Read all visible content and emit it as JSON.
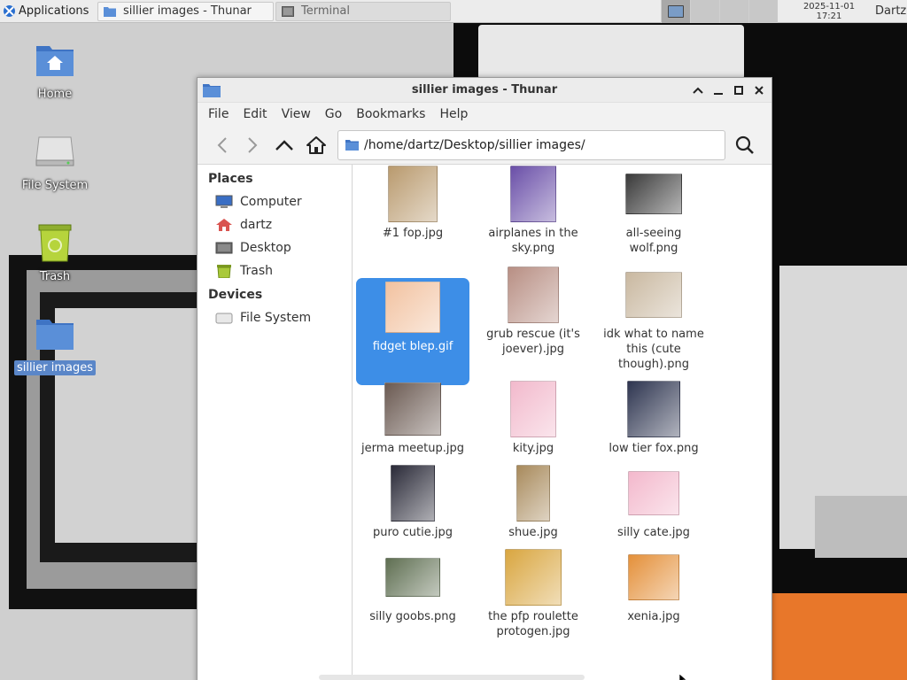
{
  "panel": {
    "applications_label": "Applications",
    "tasks": [
      {
        "label": "sillier images - Thunar"
      },
      {
        "label": "Terminal"
      }
    ],
    "clock_date": "2025-11-01",
    "clock_time": "17:21",
    "user": "Dartz"
  },
  "desktop": {
    "icons": [
      {
        "label": "Home"
      },
      {
        "label": "File System"
      },
      {
        "label": "Trash"
      },
      {
        "label": "sillier images"
      }
    ]
  },
  "window": {
    "title": "sillier images - Thunar",
    "menu": [
      "File",
      "Edit",
      "View",
      "Go",
      "Bookmarks",
      "Help"
    ],
    "location": "/home/dartz/Desktop/sillier images/",
    "sidebar": {
      "places_heading": "Places",
      "places": [
        {
          "label": "Computer"
        },
        {
          "label": "dartz"
        },
        {
          "label": "Desktop"
        },
        {
          "label": "Trash"
        }
      ],
      "devices_heading": "Devices",
      "devices": [
        {
          "label": "File System"
        }
      ]
    },
    "files": [
      {
        "name": "#1 fop.jpg",
        "color": "#b99a6e"
      },
      {
        "name": "airplanes in the sky.png",
        "color": "#6a4fa8"
      },
      {
        "name": "all-seeing wolf.png",
        "color": "#3a3a3a"
      },
      {
        "name": "fidget blep.gif",
        "color": "#f2c2a0",
        "selected": true
      },
      {
        "name": "grub rescue (it's joever).jpg",
        "color": "#b88f84"
      },
      {
        "name": "idk what to name this (cute though).png",
        "color": "#c9b8a0"
      },
      {
        "name": "jerma meetup.jpg",
        "color": "#6b5a52"
      },
      {
        "name": "kity.jpg",
        "color": "#f2b9cc"
      },
      {
        "name": "low tier fox.png",
        "color": "#2e3550"
      },
      {
        "name": "puro cutie.jpg",
        "color": "#2a2a38"
      },
      {
        "name": "shue.jpg",
        "color": "#a88a5c"
      },
      {
        "name": "silly cate.jpg",
        "color": "#f3b8cc"
      },
      {
        "name": "silly goobs.png",
        "color": "#5f6f52"
      },
      {
        "name": "the pfp roulette protogen.jpg",
        "color": "#d9a640"
      },
      {
        "name": "xenia.jpg",
        "color": "#e4903a"
      }
    ]
  },
  "colors": {
    "accent": "#3d8ee7",
    "folder": "#5a8fd8"
  }
}
